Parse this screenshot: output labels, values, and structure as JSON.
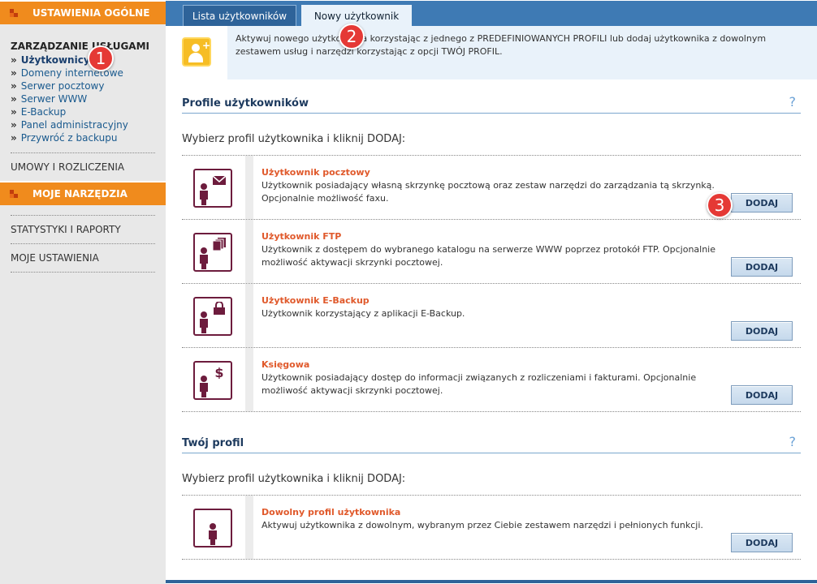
{
  "sidebar": {
    "header_general": "USTAWIENIA OGÓLNE",
    "section_title": "ZARZĄDZANIE USŁUGAMI",
    "links": [
      {
        "label": "Użytkownicy"
      },
      {
        "label": "Domeny internetowe"
      },
      {
        "label": "Serwer pocztowy"
      },
      {
        "label": "Serwer WWW"
      },
      {
        "label": "E-Backup"
      },
      {
        "label": "Panel administracyjny"
      },
      {
        "label": "Przywróć z backupu"
      }
    ],
    "contracts": "UMOWY I ROZLICZENIA",
    "header_tools": "MOJE NARZĘDZIA",
    "stats": "STATYSTYKI I RAPORTY",
    "settings": "MOJE USTAWIENIA"
  },
  "tabs": {
    "list": "Lista użytkowników",
    "new": "Nowy użytkownik"
  },
  "info": {
    "text": "Aktywuj nowego użytkownika korzystając z jednego z PREDEFINIOWANYCH PROFILI lub dodaj użytkownika z dowolnym zestawem usług i narzędzi korzystając z opcji TWÓJ PROFIL."
  },
  "profiles_section": {
    "title": "Profile użytkowników",
    "help": "?",
    "subtitle": "Wybierz profil użytkownika i kliknij DODAJ:",
    "items": [
      {
        "title": "Użytkownik pocztowy",
        "desc": "Użytkownik posiadający własną skrzynkę pocztową oraz zestaw narzędzi do zarządzania tą skrzynką. Opcjonalnie możliwość faxu.",
        "button": "DODAJ",
        "icon": "mail-user-icon"
      },
      {
        "title": "Użytkownik FTP",
        "desc": "Użytkownik z dostępem do wybranego katalogu na serwerze WWW poprzez protokół FTP. Opcjonalnie możliwość aktywacji skrzynki pocztowej.",
        "button": "DODAJ",
        "icon": "ftp-user-icon"
      },
      {
        "title": "Użytkownik E-Backup",
        "desc": "Użytkownik korzystający z aplikacji E-Backup.",
        "button": "DODAJ",
        "icon": "backup-user-icon"
      },
      {
        "title": "Księgowa",
        "desc": "Użytkownik posiadający dostęp do informacji związanych z rozliczeniami i fakturami. Opcjonalnie możliwość aktywacji skrzynki pocztowej.",
        "button": "DODAJ",
        "icon": "accountant-user-icon"
      }
    ]
  },
  "custom_section": {
    "title": "Twój profil",
    "help": "?",
    "subtitle": "Wybierz profil użytkownika i kliknij DODAJ:",
    "item": {
      "title": "Dowolny profil użytkownika",
      "desc": "Aktywuj użytkownika z dowolnym, wybranym przez Ciebie zestawem narzędzi i pełnionych funkcji.",
      "button": "DODAJ",
      "icon": "custom-user-icon"
    }
  },
  "callouts": [
    "1",
    "2",
    "3"
  ],
  "colors": {
    "accent_orange": "#f08b1d",
    "tab_blue": "#3e7ab4",
    "profile_title": "#e0592b",
    "icon_maroon": "#6d1c3d",
    "callout_red": "#e53935"
  }
}
